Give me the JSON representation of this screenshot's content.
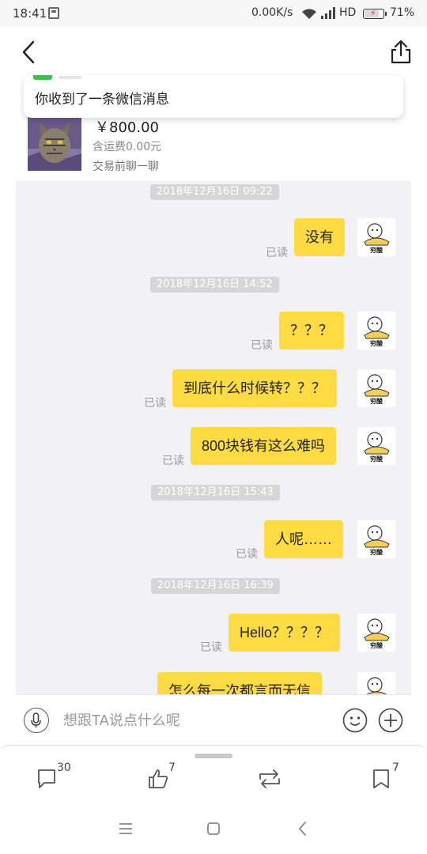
{
  "status_bar": {
    "time": "18:41",
    "net_speed": "0.00K/s",
    "network": "HD",
    "battery": "71%",
    "battery_level": 0.71
  },
  "notification": {
    "text": "你收到了一条微信消息"
  },
  "product": {
    "price": "￥800.00",
    "shipping": "含运费0.00元",
    "chat_hint": "交易前聊一聊"
  },
  "avatar_caption": "穷酸",
  "read_label": "已读",
  "messages": [
    {
      "type": "time",
      "text": "2018年12月16日 09:22"
    },
    {
      "type": "msg",
      "text": "没有"
    },
    {
      "type": "time",
      "text": "2018年12月16日 14:52"
    },
    {
      "type": "msg",
      "text": "？？？"
    },
    {
      "type": "msg",
      "text": "到底什么时候转？？？"
    },
    {
      "type": "msg",
      "text": "800块钱有这么难吗"
    },
    {
      "type": "time",
      "text": "2018年12月16日 15:43"
    },
    {
      "type": "msg",
      "text": "人呢……"
    },
    {
      "type": "time",
      "text": "2018年12月16日 16:39"
    },
    {
      "type": "msg",
      "text": "Hello？？？？"
    },
    {
      "type": "msg",
      "text": "怎么每一次都言而无信"
    }
  ],
  "input": {
    "placeholder": "想跟TA说点什么呢"
  },
  "actions": {
    "comments": "30",
    "likes": "7",
    "favorites": "7"
  },
  "colors": {
    "bubble": "#fedb43",
    "chat_background": "#f1f1f6",
    "timestamp_background": "#d6d6d6",
    "wechat_green": "#35c447"
  }
}
